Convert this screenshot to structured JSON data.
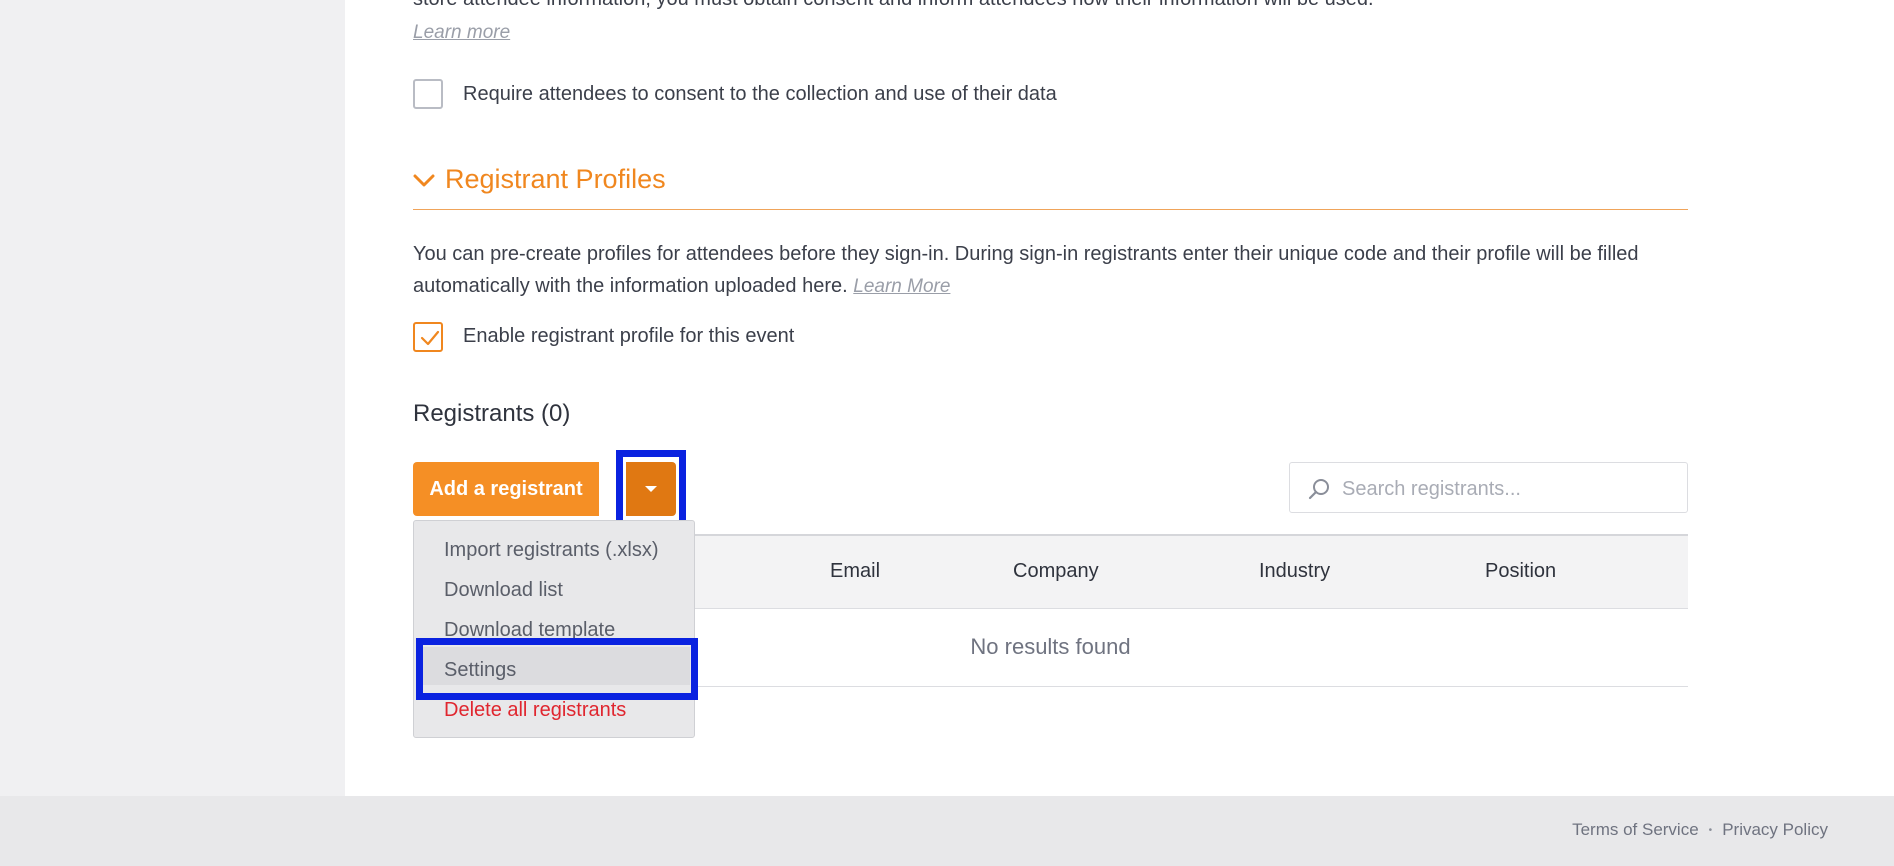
{
  "privacy": {
    "text_line": "store attendee information, you must obtain consent and inform attendees how their information will be used.",
    "learn_more": "Learn more",
    "consent_checkbox_label": "Require attendees to consent to the collection and use of their data",
    "consent_checked": false
  },
  "registrant_profiles": {
    "title": "Registrant Profiles",
    "description": "You can pre-create profiles for attendees before they sign-in. During sign-in registrants enter their unique code and their profile will be filled automatically with the information uploaded here.",
    "learn_more": "Learn More",
    "enable_label": "Enable registrant profile for this event",
    "enable_checked": true
  },
  "registrants": {
    "heading": "Registrants (0)",
    "add_button": "Add a registrant",
    "search_placeholder": "Search registrants...",
    "columns": [
      "Email",
      "Company",
      "Industry",
      "Position"
    ],
    "empty_text": "No results found",
    "menu": {
      "import": "Import registrants (.xlsx)",
      "download_list": "Download list",
      "download_template": "Download template",
      "settings": "Settings",
      "delete_all": "Delete all registrants"
    }
  },
  "footer": {
    "terms": "Terms of Service",
    "privacy": "Privacy Policy",
    "separator": "•"
  },
  "colors": {
    "accent": "#f58f25",
    "accent_dark": "#e07812",
    "highlight": "#0a22e0",
    "danger": "#e0262f"
  },
  "icons": {
    "section_toggle": "chevron-down-icon",
    "split_toggle": "caret-down-icon",
    "search": "search-icon",
    "checkmark": "checkmark-icon"
  }
}
